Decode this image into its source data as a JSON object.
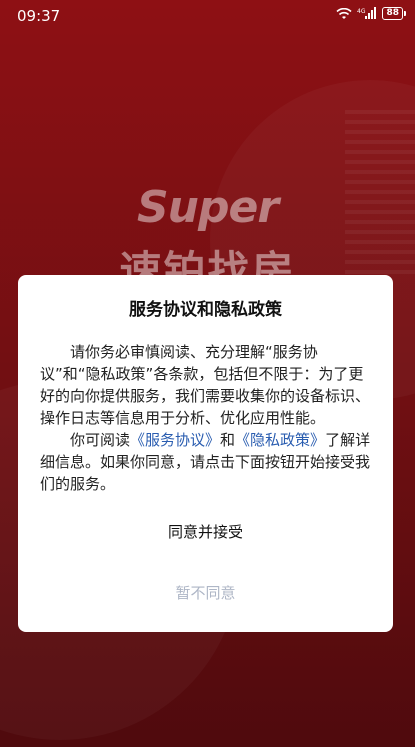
{
  "status_bar": {
    "time": "09:37",
    "network": "4G",
    "battery": "88"
  },
  "background": {
    "brand_en": "Super",
    "brand_cn": "速铂找房"
  },
  "dialog": {
    "title": "服务协议和隐私政策",
    "para1": "请你务必审慎阅读、充分理解“服务协议”和“隐私政策”各条款，包括但不限于：为了更好的向你提供服务，我们需要收集你的设备标识、操作日志等信息用于分析、优化应用性能。",
    "para2_prefix": "你可阅读",
    "service_link": "《服务协议》",
    "para2_and": "和",
    "privacy_link": "《隐私政策》",
    "para2_suffix": "了解详细信息。如果你同意，请点击下面按钮开始接受我们的服务。",
    "agree_label": "同意并接受",
    "disagree_label": "暂不同意"
  },
  "colors": {
    "background": "#7d0f13",
    "link": "#2a5db0",
    "disagree_text": "#aeb6c6"
  }
}
